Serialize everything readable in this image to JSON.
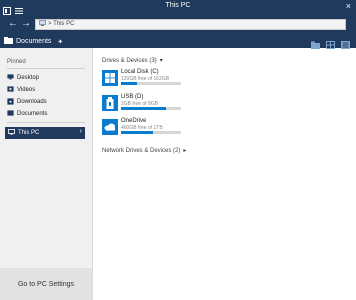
{
  "window": {
    "title": "This PC"
  },
  "address": {
    "path": "> This PC"
  },
  "location": {
    "title": "Documents"
  },
  "sidebar": {
    "pinned_label": "Pinned",
    "items": [
      {
        "label": "Desktop"
      },
      {
        "label": "Videos"
      },
      {
        "label": "Downloads"
      },
      {
        "label": "Documents"
      }
    ],
    "this_pc_label": "This PC",
    "settings_label": "Go to PC Settings"
  },
  "drives_section": {
    "label": "Drives & Devices (3)"
  },
  "drives": [
    {
      "name": "Local Disk (C)",
      "space": "120GB free of 162GB",
      "used_fraction": 0.26,
      "icon": "windows-logo-icon"
    },
    {
      "name": "USB (D)",
      "space": "2GB free of 8GB",
      "used_fraction": 0.75,
      "icon": "usb-drive-icon"
    },
    {
      "name": "OneDrive",
      "space": "460GB free of 1TB",
      "used_fraction": 0.54,
      "icon": "onedrive-cloud-icon"
    }
  ],
  "network_section": {
    "label": "Network Drives & Devices (2)"
  },
  "colors": {
    "accent": "#1f3a5c",
    "drive_blue": "#0a7ccf"
  }
}
